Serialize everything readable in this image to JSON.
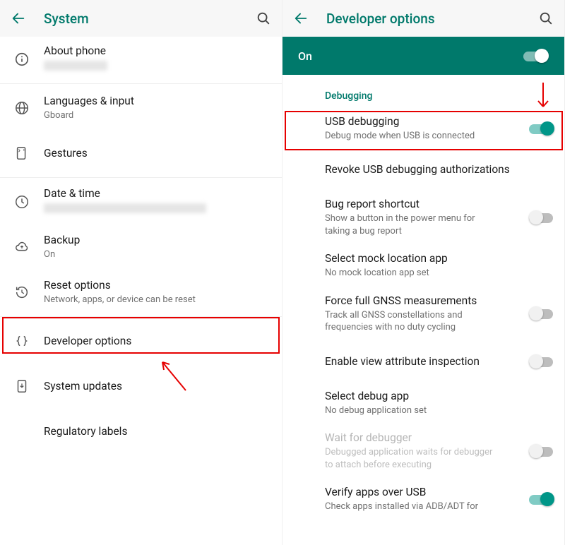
{
  "left": {
    "title": "System",
    "items": [
      {
        "key": "about-phone",
        "label": "About phone",
        "sub_redacted": true,
        "icon": "info"
      },
      {
        "key": "languages-input",
        "label": "Languages & input",
        "sub": "Gboard",
        "icon": "globe"
      },
      {
        "key": "gestures",
        "label": "Gestures",
        "icon": "gesture"
      },
      {
        "key": "date-time",
        "label": "Date & time",
        "sub_redacted_long": true,
        "icon": "clock"
      },
      {
        "key": "backup",
        "label": "Backup",
        "sub": "On",
        "icon": "cloud"
      },
      {
        "key": "reset",
        "label": "Reset options",
        "sub": "Network, apps, or device can be reset",
        "icon": "history"
      },
      {
        "key": "developer-options",
        "label": "Developer options",
        "icon": "braces"
      },
      {
        "key": "system-updates",
        "label": "System updates",
        "icon": "device-download"
      },
      {
        "key": "regulatory",
        "label": "Regulatory labels",
        "icon": "none"
      }
    ]
  },
  "right": {
    "title": "Developer options",
    "master_label": "On",
    "section": "Debugging",
    "items": [
      {
        "key": "usb-debugging",
        "label": "USB debugging",
        "sub": "Debug mode when USB is connected",
        "toggle": "on"
      },
      {
        "key": "revoke-usb",
        "label": "Revoke USB debugging authorizations"
      },
      {
        "key": "bug-report-shortcut",
        "label": "Bug report shortcut",
        "sub": "Show a button in the power menu for taking a bug report",
        "toggle": "off"
      },
      {
        "key": "mock-location",
        "label": "Select mock location app",
        "sub": "No mock location app set"
      },
      {
        "key": "force-gnss",
        "label": "Force full GNSS measurements",
        "sub": "Track all GNSS constellations and frequencies with no duty cycling",
        "toggle": "off"
      },
      {
        "key": "view-attr",
        "label": "Enable view attribute inspection",
        "toggle": "off"
      },
      {
        "key": "select-debug-app",
        "label": "Select debug app",
        "sub": "No debug application set"
      },
      {
        "key": "wait-debugger",
        "label": "Wait for debugger",
        "sub": "Debugged application waits for debugger to attach before executing",
        "toggle": "off",
        "disabled": true
      },
      {
        "key": "verify-apps-usb",
        "label": "Verify apps over USB",
        "sub": "Check apps installed via ADB/ADT for",
        "toggle": "on"
      }
    ]
  },
  "colors": {
    "teal": "#00796b",
    "tealLight": "#009688",
    "red": "#e60000"
  }
}
